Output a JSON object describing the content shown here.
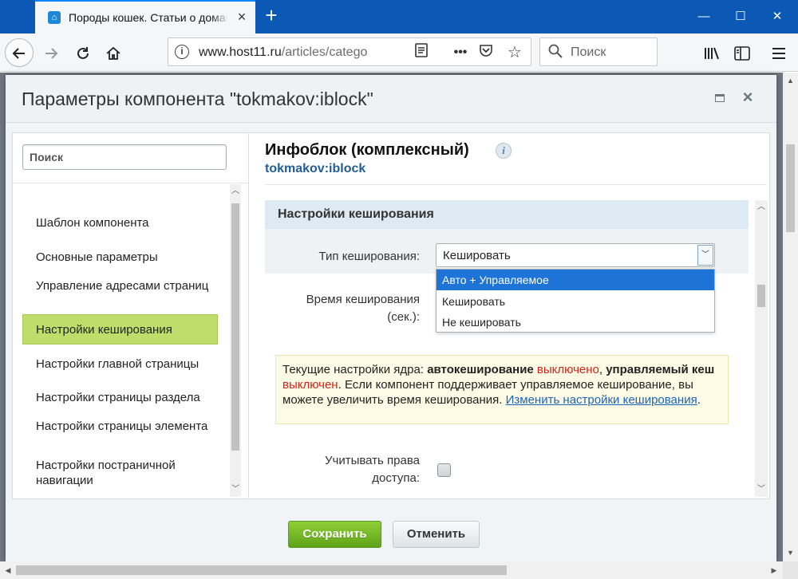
{
  "browser": {
    "tab_title": "Породы кошек. Статьи о домашних",
    "tab_close_glyph": "×",
    "new_tab_glyph": "+",
    "url_host": "www.host11.ru",
    "url_path": "/articles/catego",
    "search_placeholder": "Поиск",
    "window_controls": {
      "minimize": "—",
      "maximize": "☐",
      "close": "✕"
    },
    "icons": [
      "back-arrow-icon",
      "forward-arrow-icon",
      "reload-icon",
      "home-icon",
      "info-icon",
      "reader-view-icon",
      "more-actions-icon",
      "pocket-icon",
      "bookmark-star-icon",
      "search-icon",
      "library-icon",
      "sidebar-icon",
      "hamburger-menu-icon"
    ]
  },
  "dialog": {
    "title": "Параметры компонента \"tokmakov:iblock\"",
    "left": {
      "search_label": "Поиск",
      "items": [
        {
          "label": "Шаблон компонента",
          "active": false
        },
        {
          "label": "Основные параметры",
          "active": false
        },
        {
          "label": "Управление адресами страниц",
          "active": false
        },
        {
          "label": "Настройки кеширования",
          "active": true
        },
        {
          "label": "Настройки главной страницы",
          "active": false
        },
        {
          "label": "Настройки страницы раздела",
          "active": false
        },
        {
          "label": "Настройки страницы элемента",
          "active": false
        },
        {
          "label": "Настройки постраничной навигации",
          "active": false
        }
      ]
    },
    "right": {
      "title": "Инфоблок (комплексный)",
      "info_glyph": "i",
      "subtitle": "tokmakov:iblock",
      "section_title": "Настройки кеширования",
      "cache_type_label": "Тип кеширования:",
      "cache_type_value": "Кешировать",
      "cache_type_options": [
        "Авто + Управляемое",
        "Кешировать",
        "Не кешировать"
      ],
      "cache_type_highlighted": "Авто + Управляемое",
      "cache_time_label_1": "Время кеширования",
      "cache_time_label_2": "(сек.):",
      "notice": {
        "part1": "Текущие настройки ядра: ",
        "bold1": "автокеширование",
        "red1": " выключено",
        "part2": ", ",
        "bold2": "управляемый кеш",
        "red2": " выключен",
        "part3": ". Если компонент поддерживает управляемое кеширование, вы можете увеличить время кеширования. ",
        "link": "Изменить настройки кеширования",
        "part4": "."
      },
      "access_label_1": "Учитывать права",
      "access_label_2": "доступа:",
      "access_checked": false
    },
    "buttons": {
      "save": "Сохранить",
      "cancel": "Отменить"
    }
  }
}
